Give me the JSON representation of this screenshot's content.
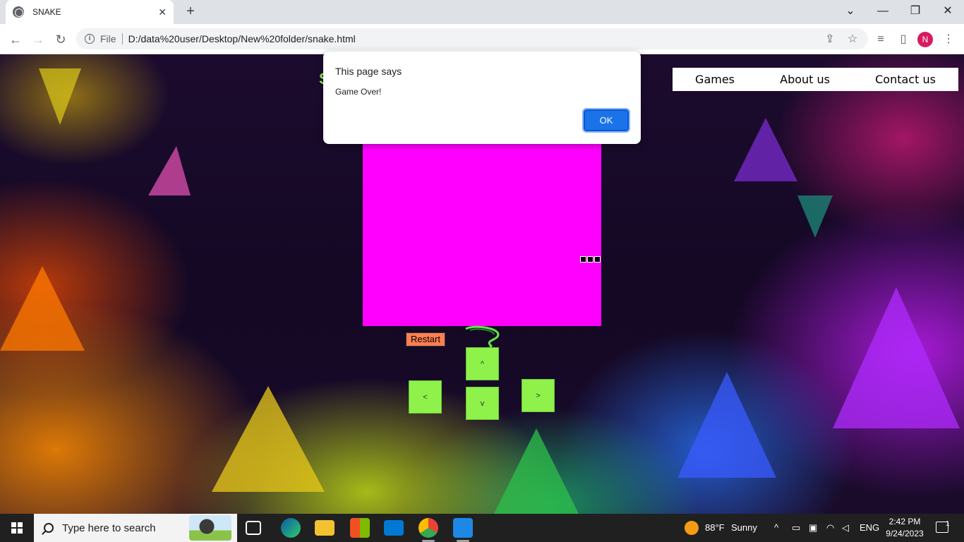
{
  "browser": {
    "tab_title": "SNAKE",
    "tab_close": "✕",
    "new_tab": "+",
    "url_scheme_label": "File",
    "url": "D:/data%20user/Desktop/New%20folder/snake.html",
    "profile_initial": "N"
  },
  "window_controls": {
    "tab_search": "⌄",
    "minimize": "—",
    "restore": "❐",
    "close": "✕"
  },
  "page": {
    "title_fragment": "S",
    "nav": {
      "games": "Games",
      "about": "About us",
      "contact": "Contact us"
    },
    "restart_label": "Restart",
    "controls": {
      "up": "^",
      "down": "v",
      "left": "<",
      "right": ">"
    },
    "board_color": "#ff00ff",
    "button_color": "#8ef24a"
  },
  "dialog": {
    "title": "This page says",
    "message": "Game Over!",
    "ok_label": "OK"
  },
  "taskbar": {
    "search_placeholder": "Type here to search",
    "weather_temp": "88°F",
    "weather_text": "Sunny",
    "language": "ENG",
    "time": "2:42 PM",
    "date": "9/24/2023",
    "notification_count": "1"
  }
}
